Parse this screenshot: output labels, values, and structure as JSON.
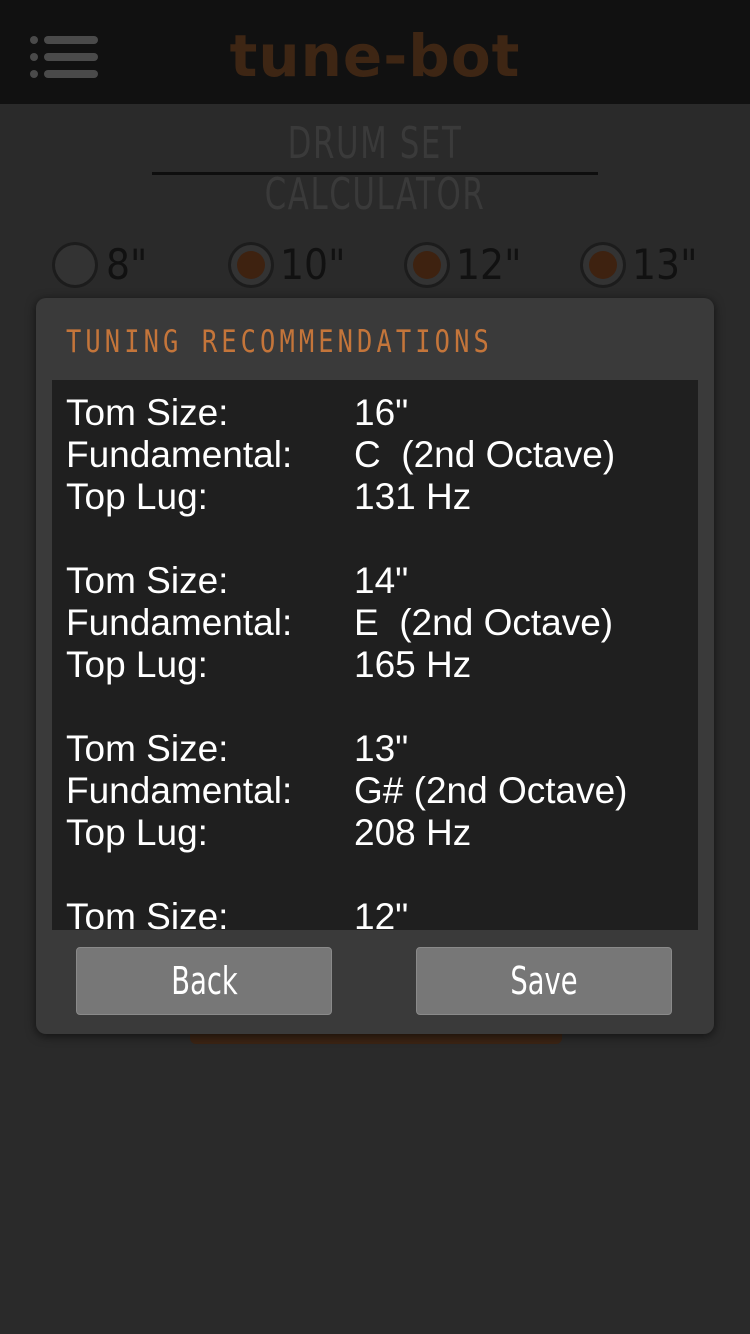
{
  "app": {
    "brand": "tune-bot",
    "page_title": "DRUM SET CALCULATOR"
  },
  "size_options": [
    {
      "label": "8\"",
      "selected": false
    },
    {
      "label": "10\"",
      "selected": true
    },
    {
      "label": "12\"",
      "selected": true
    },
    {
      "label": "13\"",
      "selected": true
    }
  ],
  "modal": {
    "title": "TUNING RECOMMENDATIONS",
    "labels": {
      "tom_size": "Tom Size:",
      "fundamental": "Fundamental:",
      "top_lug": "Top Lug:"
    },
    "recommendations": [
      {
        "tom_size": "16\"",
        "fundamental": "C  (2nd Octave)",
        "top_lug": "131 Hz"
      },
      {
        "tom_size": "14\"",
        "fundamental": "E  (2nd Octave)",
        "top_lug": "165 Hz"
      },
      {
        "tom_size": "13\"",
        "fundamental": "G# (2nd Octave)",
        "top_lug": "208 Hz"
      },
      {
        "tom_size": "12\"",
        "fundamental": "",
        "top_lug": ""
      }
    ],
    "back_label": "Back",
    "save_label": "Save"
  },
  "colors": {
    "accent": "#c4753a",
    "brand_dim": "#3e2614",
    "modal_bg": "#3a3a3a",
    "list_bg": "#1f1f1f",
    "button_bg": "#777777"
  }
}
